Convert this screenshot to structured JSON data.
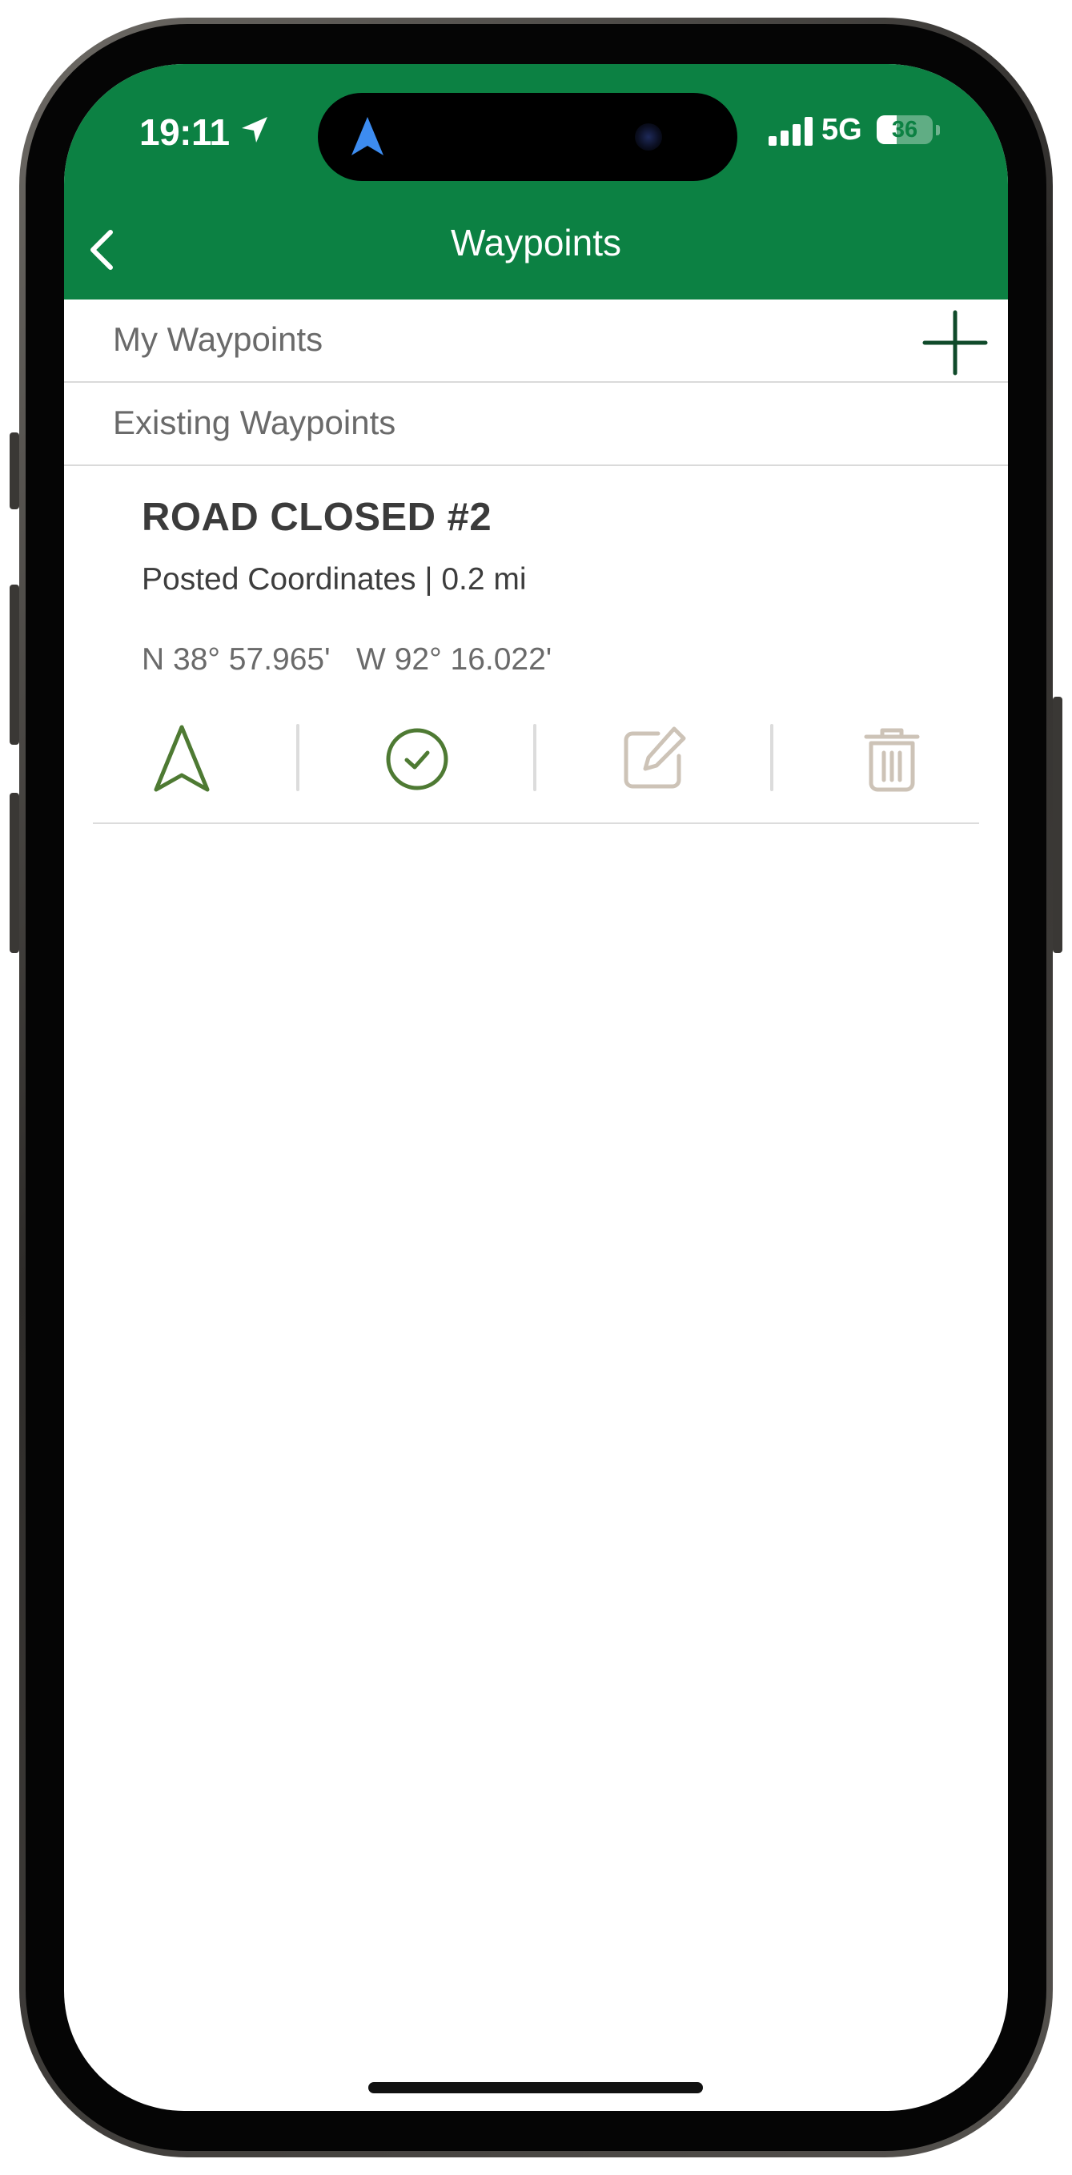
{
  "status_bar": {
    "time": "19:11",
    "network": "5G",
    "battery_level": "36"
  },
  "header": {
    "title": "Waypoints"
  },
  "sections": {
    "my_waypoints_label": "My Waypoints",
    "existing_waypoints_label": "Existing Waypoints"
  },
  "waypoints": [
    {
      "name": "ROAD CLOSED #2",
      "subtitle": "Posted Coordinates | 0.2 mi",
      "coordinates": "N 38° 57.965'   W 92° 16.022'"
    }
  ],
  "icons": {
    "back": "chevron-left-icon",
    "add": "plus-icon",
    "navigate": "navigation-arrow-icon",
    "complete": "check-circle-icon",
    "edit": "edit-icon",
    "delete": "trash-icon"
  },
  "colors": {
    "header_green": "#0c8143",
    "action_green": "#4e7a33",
    "disabled_beige": "#cdc3b7",
    "add_icon": "#0f4a2a"
  }
}
